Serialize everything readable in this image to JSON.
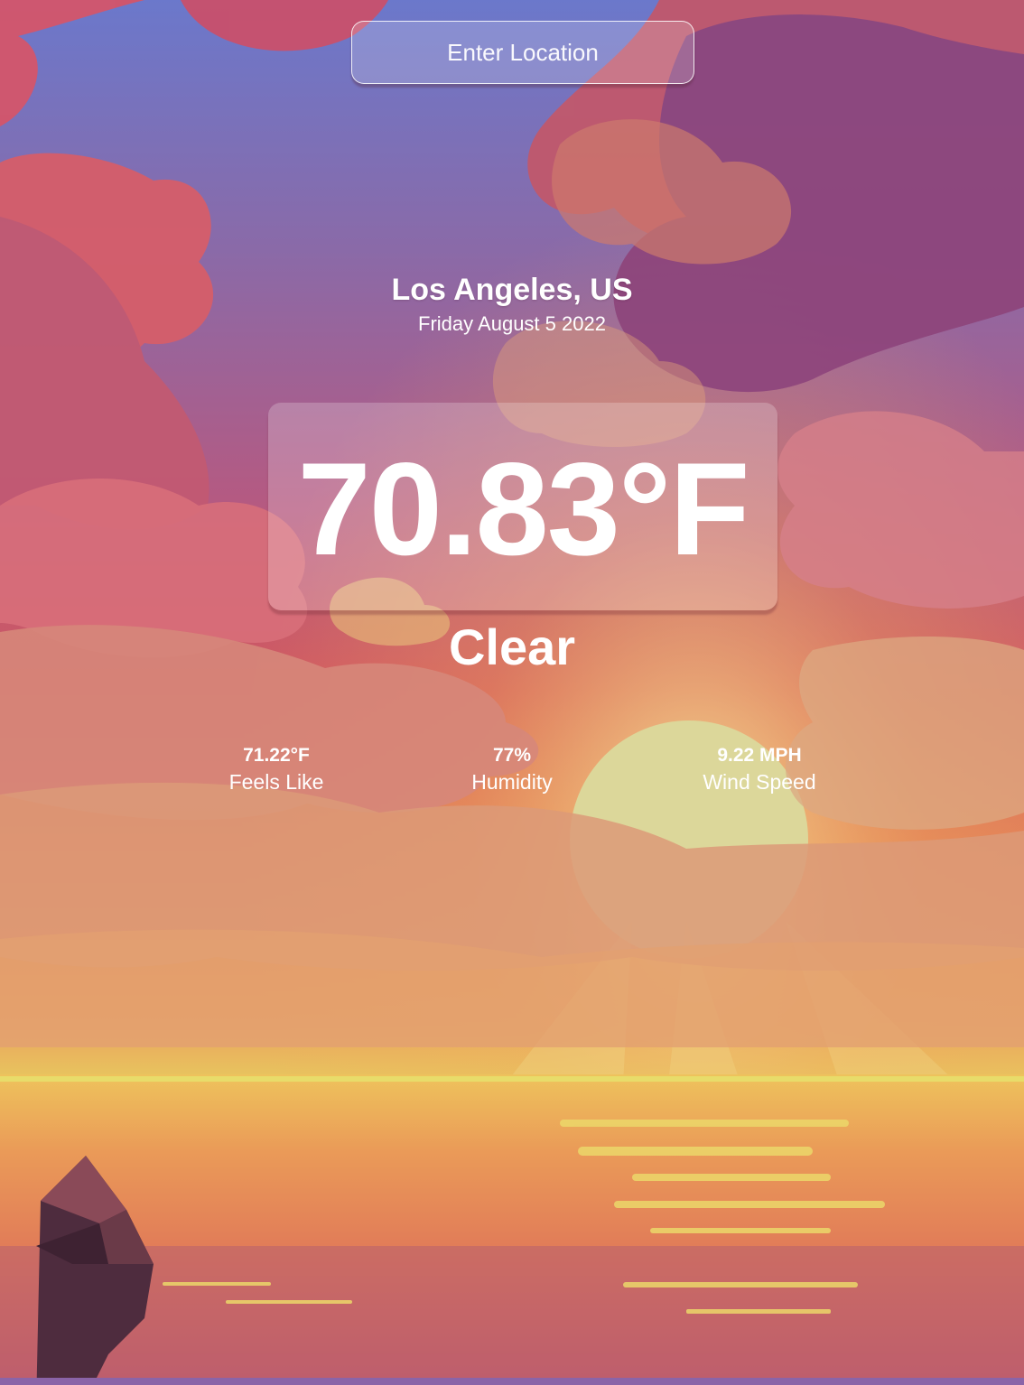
{
  "search": {
    "placeholder": "Enter Location"
  },
  "location": {
    "name": "Los Angeles, US",
    "date": "Friday August 5 2022"
  },
  "current": {
    "temperature": "70.83°F",
    "condition": "Clear"
  },
  "stats": {
    "feels_like": {
      "value": "71.22°F",
      "label": "Feels Like"
    },
    "humidity": {
      "value": "77%",
      "label": "Humidity"
    },
    "wind_speed": {
      "value": "9.22 MPH",
      "label": "Wind Speed"
    }
  },
  "background": {
    "scene": "sunset-sea-illustration",
    "colors": {
      "sky_top": "#6f78c9",
      "sky_mid": "#c85a6e",
      "horizon": "#f0b262",
      "sun": "#e2dc9a",
      "sea": "#e07e5a",
      "cloud_pink": "#d96670",
      "cloud_purple": "#9a4a7e",
      "rock": "#6a3a48"
    }
  }
}
